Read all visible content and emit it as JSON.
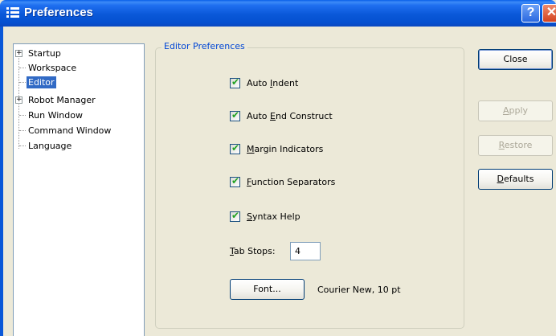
{
  "window": {
    "title": "Preferences",
    "help_glyph": "?",
    "close_glyph": "✕",
    "icon": "app-icon"
  },
  "tree": {
    "items": [
      {
        "label": "Startup",
        "expandable": true,
        "selected": false
      },
      {
        "label": "Workspace",
        "expandable": false,
        "selected": false
      },
      {
        "label": "Editor",
        "expandable": false,
        "selected": true
      },
      {
        "label": "Robot Manager",
        "expandable": true,
        "selected": false
      },
      {
        "label": "Run Window",
        "expandable": false,
        "selected": false
      },
      {
        "label": "Command Window",
        "expandable": false,
        "selected": false
      },
      {
        "label": "Language",
        "expandable": false,
        "selected": false
      }
    ],
    "expander_glyph": "+"
  },
  "editor": {
    "group_title": "Editor Preferences",
    "checkboxes": [
      {
        "pre": "Auto ",
        "key": "I",
        "post": "ndent",
        "checked": true
      },
      {
        "pre": "Auto ",
        "key": "E",
        "post": "nd Construct",
        "checked": true
      },
      {
        "pre": "",
        "key": "M",
        "post": "argin Indicators",
        "checked": true
      },
      {
        "pre": "",
        "key": "F",
        "post": "unction Separators",
        "checked": true
      },
      {
        "pre": "",
        "key": "S",
        "post": "yntax Help",
        "checked": true
      }
    ],
    "check_glyph": "✔",
    "tab_stops_key": "T",
    "tab_stops_rest": "ab Stops:",
    "tab_stops_value": "4",
    "font_button": "Font...",
    "font_value": "Courier New, 10 pt"
  },
  "buttons": {
    "close": "Close",
    "apply_key": "A",
    "apply_rest": "pply",
    "restore_key": "R",
    "restore_rest": "estore",
    "defaults_key": "D",
    "defaults_rest": "efaults"
  },
  "colors": {
    "titlebar": "#0a58d8",
    "selection": "#316ac5",
    "group_title": "#0046d5",
    "checkmark": "#21a121"
  }
}
